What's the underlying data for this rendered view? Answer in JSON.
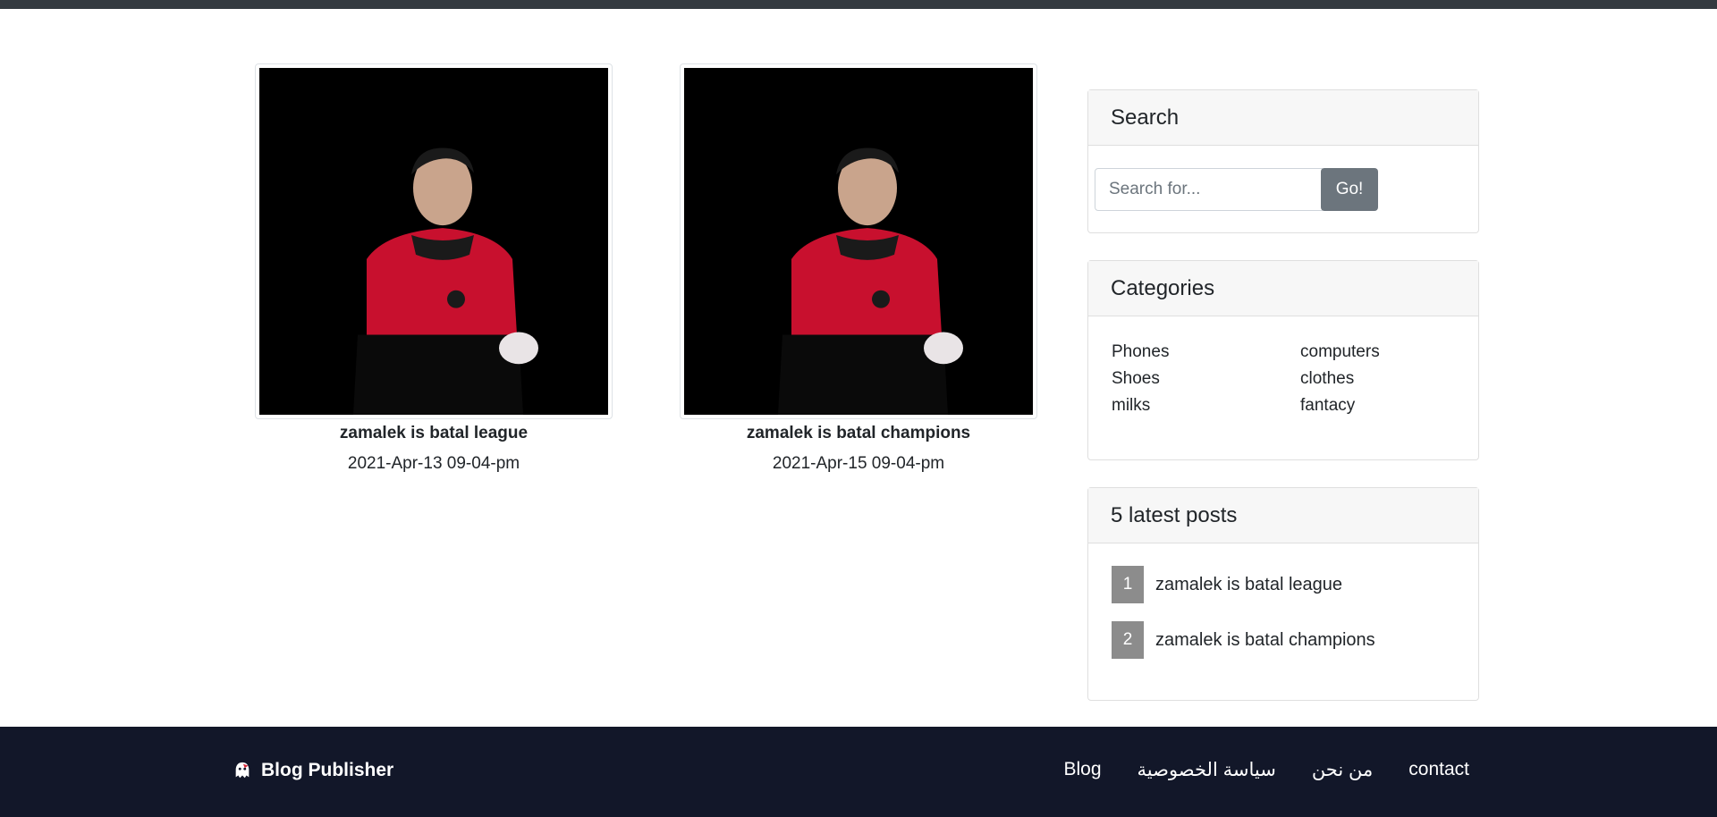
{
  "posts": [
    {
      "title": "zamalek is batal league",
      "date": "2021-Apr-13 09-04-pm",
      "image_desc": "person-photo"
    },
    {
      "title": "zamalek is batal champions",
      "date": "2021-Apr-15 09-04-pm",
      "image_desc": "person-photo"
    }
  ],
  "sidebar": {
    "search": {
      "title": "Search",
      "placeholder": "Search for...",
      "button_label": "Go!"
    },
    "categories": {
      "title": "Categories",
      "items": [
        "Phones",
        "computers",
        "Shoes",
        "clothes",
        "milks",
        "fantacy"
      ]
    },
    "latest": {
      "title": "5 latest posts",
      "items": [
        {
          "num": "1",
          "title": "zamalek is batal league"
        },
        {
          "num": "2",
          "title": "zamalek is batal champions"
        }
      ]
    }
  },
  "footer": {
    "brand": "Blog Publisher",
    "brand_icon": "ghost-icon",
    "nav": [
      "Blog",
      "سياسة الخصوصية",
      "من نحن",
      "contact"
    ]
  },
  "colors": {
    "topbar": "#343a40",
    "footer_bg": "#121729",
    "go_button": "#6c757d",
    "number_badge": "#8c8c8c"
  }
}
